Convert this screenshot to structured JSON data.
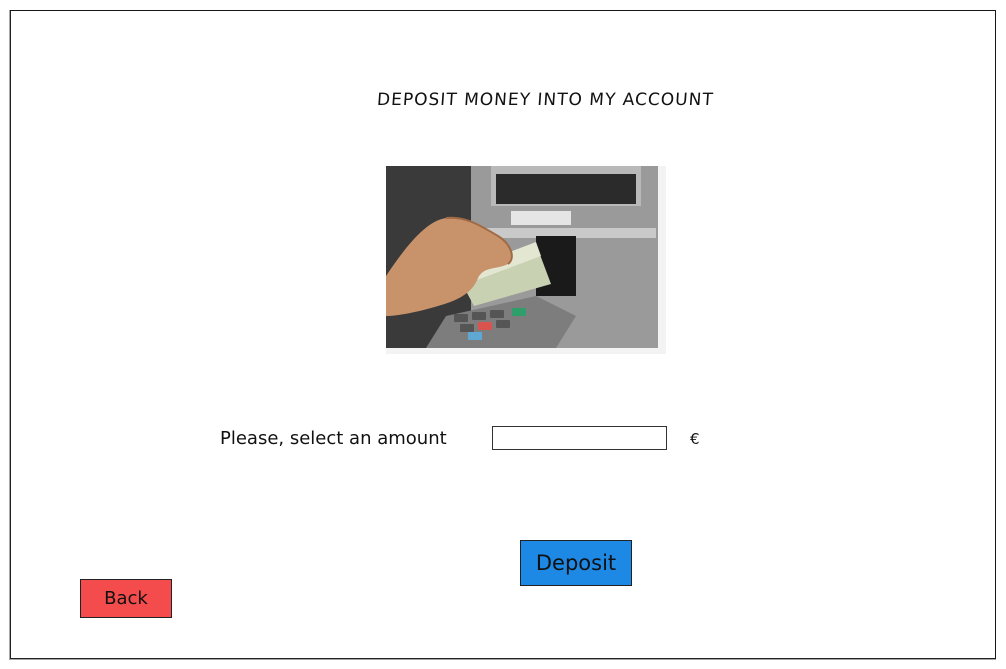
{
  "header": {
    "title": "DEPOSIT MONEY INTO MY ACCOUNT"
  },
  "image": {
    "icon": "atm-cash-deposit-photo"
  },
  "form": {
    "amount_label": "Please, select an amount",
    "amount_value": "",
    "currency": "€"
  },
  "actions": {
    "deposit_label": "Deposit",
    "back_label": "Back"
  },
  "colors": {
    "deposit_button": "#1e88e5",
    "back_button": "#f44c4c",
    "border": "#222222"
  }
}
